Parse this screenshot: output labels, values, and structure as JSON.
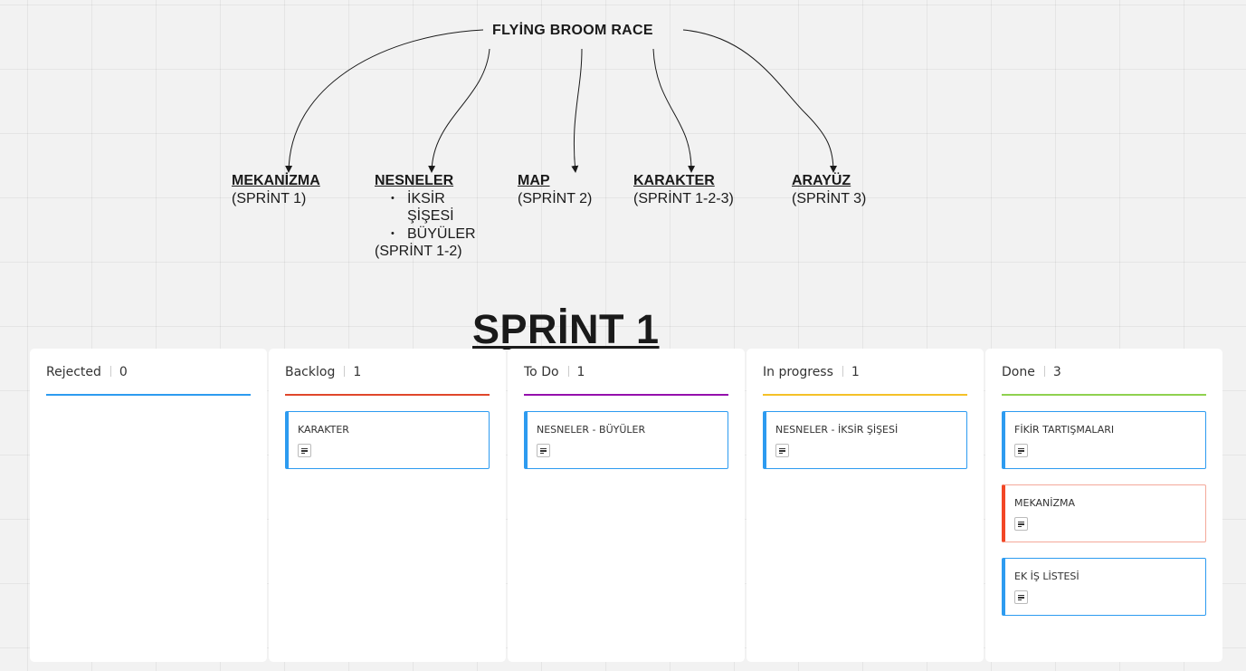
{
  "mindmap": {
    "title": "FLYİNG BROOM RACE",
    "nodes": [
      {
        "head": "MEKANİZMA",
        "lines": [
          "(SPRİNT 1)"
        ],
        "bullets": []
      },
      {
        "head": "NESNELER",
        "bullets": [
          "İKSİR",
          "ŞİŞESİ",
          "BÜYÜLER"
        ],
        "lines": [
          "(SPRİNT 1-2)"
        ]
      },
      {
        "head": "MAP",
        "lines": [
          "(SPRİNT 2)"
        ],
        "bullets": []
      },
      {
        "head": "KARAKTER",
        "lines": [
          "(SPRİNT 1-2-3)"
        ],
        "bullets": []
      },
      {
        "head": "ARAYÜZ",
        "lines": [
          "(SPRİNT 3)"
        ],
        "bullets": []
      }
    ]
  },
  "sprint_title": "SPRİNT 1",
  "kanban": {
    "columns": [
      {
        "name": "Rejected",
        "count": "0",
        "color": "#2d9bf0",
        "cards": []
      },
      {
        "name": "Backlog",
        "count": "1",
        "color": "#e0472b",
        "cards": [
          {
            "title": "KARAKTER",
            "color": "#2d9bf0"
          }
        ]
      },
      {
        "name": "To Do",
        "count": "1",
        "color": "#9510ac",
        "cards": [
          {
            "title": "NESNELER - BÜYÜLER",
            "color": "#2d9bf0"
          }
        ]
      },
      {
        "name": "In progress",
        "count": "1",
        "color": "#f5c127",
        "cards": [
          {
            "title": "NESNELER - İKSİR ŞİŞESİ",
            "color": "#2d9bf0"
          }
        ]
      },
      {
        "name": "Done",
        "count": "3",
        "color": "#8fd14f",
        "cards": [
          {
            "title": "FİKİR TARTIŞMALARI",
            "color": "#2d9bf0"
          },
          {
            "title": "MEKANİZMA",
            "color": "#f24726"
          },
          {
            "title": "EK İŞ LİSTESİ",
            "color": "#2d9bf0"
          }
        ]
      }
    ]
  }
}
